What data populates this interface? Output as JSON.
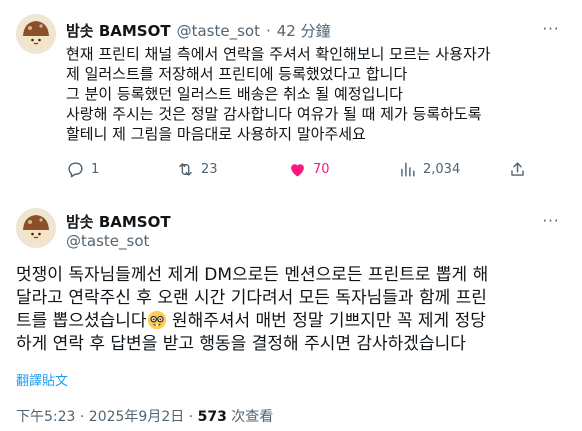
{
  "reply_tweet": {
    "display_name": "밤솟 BAMSOT",
    "handle": "@taste_sot",
    "separator": "·",
    "time": "42 分鐘",
    "lines": [
      "현재 프린티 채널 측에서 연락을 주셔서 확인해보니 모르는 사용자가",
      "제 일러스트를 저장해서 프린티에 등록했었다고 합니다",
      "그 분이 등록했던 일러스트 배송은 취소 될 예정입니다",
      "사랑해 주시는 것은 정말 감사합니다 여유가 될 때 제가 등록하도록",
      "할테니 제 그림을 마음대로 사용하지 말아주세요"
    ],
    "actions": {
      "replies": "1",
      "reposts": "23",
      "likes": "70",
      "views": "2,034"
    },
    "colors": {
      "like": "#f91880",
      "muted": "#536471"
    }
  },
  "main_tweet": {
    "display_name": "밤솟 BAMSOT",
    "handle": "@taste_sot",
    "lines": [
      "멋쟁이 독자님들께선 제게 DM으로든 멘션으로든 프린트로 뽑게 해",
      "달라고 연락주신 후 오랜 시간 기다려서 모든 독자님들과 함께 프린",
      "트를 뽑으셨습니다",
      " 원해주셔서 매번 정말 기쁘지만 꼭 제게 정당",
      "하게 연락 후 답변을 받고 행동을 결정해 주시면 감사하겠습니다"
    ],
    "emoji": "nerd-face-icon",
    "translate_label": "翻譯貼文",
    "timestamp": "下午5:23 · 2025年9月2日 · ",
    "views_count": "573",
    "views_label": " 次查看",
    "colors": {
      "link": "#1d9bf0"
    }
  }
}
